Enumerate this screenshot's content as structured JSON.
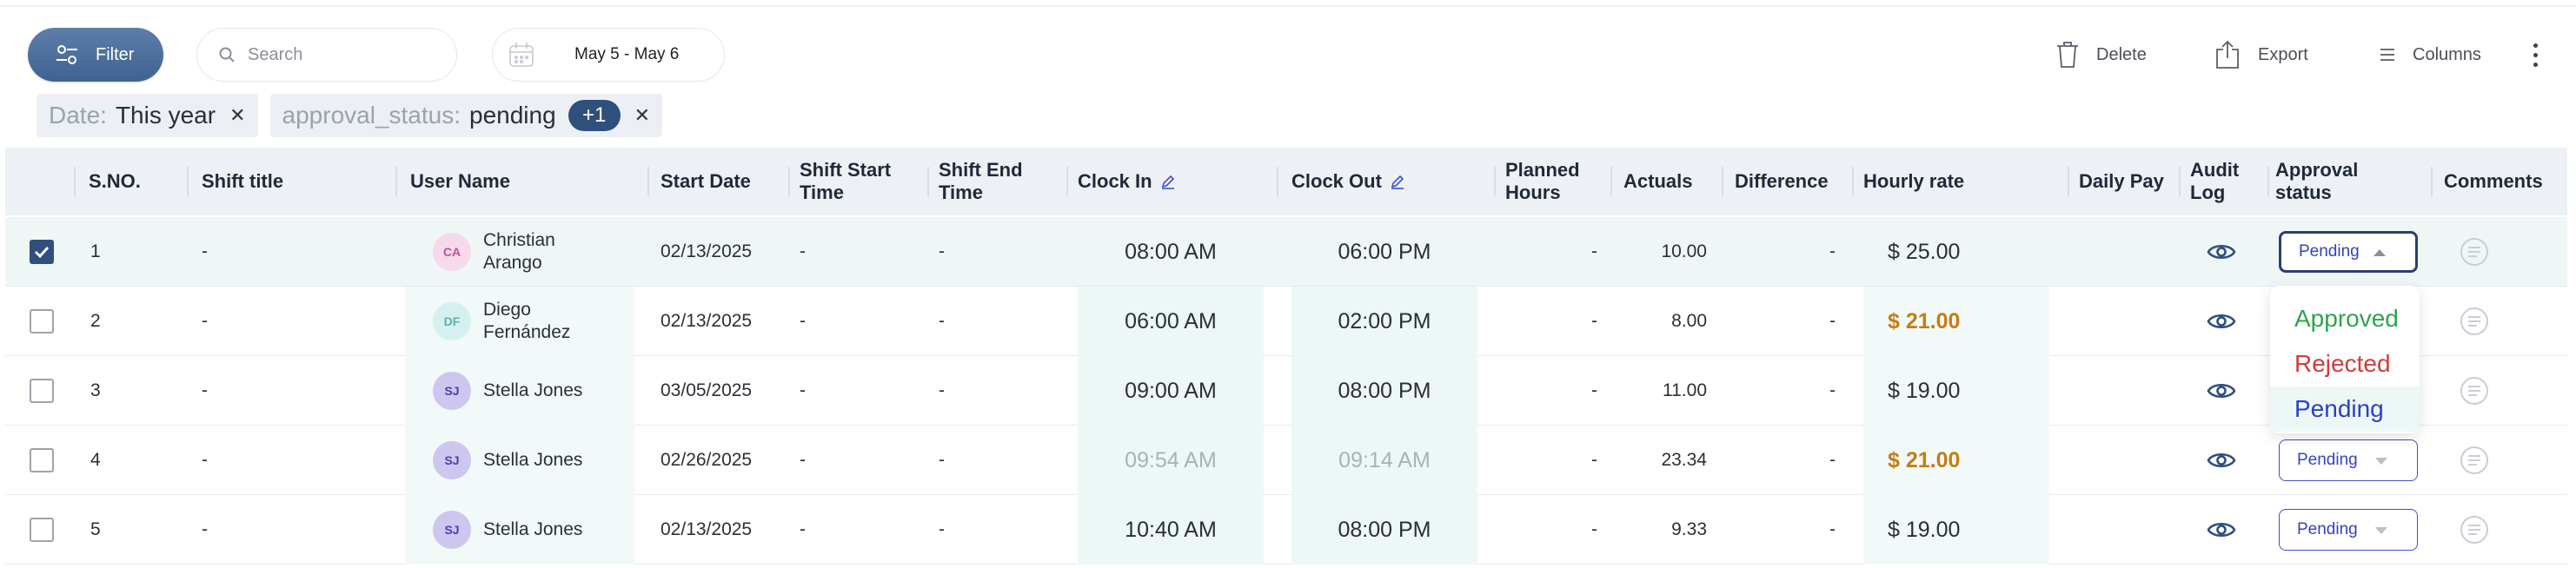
{
  "toolbar": {
    "filter_label": "Filter",
    "search_placeholder": "Search",
    "date_range": "May 5 - May 6",
    "delete_label": "Delete",
    "export_label": "Export",
    "columns_label": "Columns"
  },
  "chips": [
    {
      "key": "Date:",
      "value": "This year"
    },
    {
      "key": "approval_status:",
      "value": "pending",
      "extra": "+1"
    }
  ],
  "columns": {
    "sno": "S.NO.",
    "shift_title": "Shift title",
    "user_name": "User Name",
    "start_date": "Start Date",
    "shift_start": "Shift Start Time",
    "shift_end": "Shift End Time",
    "clock_in": "Clock In",
    "clock_out": "Clock Out",
    "planned_hours": "Planned Hours",
    "actuals": "Actuals",
    "difference": "Difference",
    "hourly_rate": "Hourly rate",
    "daily_pay": "Daily Pay",
    "audit_log": "Audit Log",
    "approval_status": "Approval status",
    "comments": "Comments"
  },
  "rows": [
    {
      "sno": "1",
      "shift_title": "-",
      "initials": "CA",
      "user": "Christian Arango",
      "start_date": "02/13/2025",
      "shift_start": "-",
      "shift_end": "-",
      "clock_in": "08:00 AM",
      "clock_out": "06:00 PM",
      "planned": "-",
      "actuals": "10.00",
      "difference": "-",
      "rate": "$ 25.00",
      "status": "Pending"
    },
    {
      "sno": "2",
      "shift_title": "-",
      "initials": "DF",
      "user": "Diego Fernández",
      "start_date": "02/13/2025",
      "shift_start": "-",
      "shift_end": "-",
      "clock_in": "06:00 AM",
      "clock_out": "02:00 PM",
      "planned": "-",
      "actuals": "8.00",
      "difference": "-",
      "rate": "$ 21.00",
      "status": "Pending"
    },
    {
      "sno": "3",
      "shift_title": "-",
      "initials": "SJ",
      "user": "Stella Jones",
      "start_date": "03/05/2025",
      "shift_start": "-",
      "shift_end": "-",
      "clock_in": "09:00 AM",
      "clock_out": "08:00 PM",
      "planned": "-",
      "actuals": "11.00",
      "difference": "-",
      "rate": "$ 19.00",
      "status": "Pending"
    },
    {
      "sno": "4",
      "shift_title": "-",
      "initials": "SJ",
      "user": "Stella Jones",
      "start_date": "02/26/2025",
      "shift_start": "-",
      "shift_end": "-",
      "clock_in": "09:54 AM",
      "clock_out": "09:14 AM",
      "planned": "-",
      "actuals": "23.34",
      "difference": "-",
      "rate": "$ 21.00",
      "status": "Pending"
    },
    {
      "sno": "5",
      "shift_title": "-",
      "initials": "SJ",
      "user": "Stella Jones",
      "start_date": "02/13/2025",
      "shift_start": "-",
      "shift_end": "-",
      "clock_in": "10:40 AM",
      "clock_out": "08:00 PM",
      "planned": "-",
      "actuals": "9.33",
      "difference": "-",
      "rate": "$ 19.00",
      "status": "Pending"
    }
  ],
  "status_options": [
    "Approved",
    "Rejected",
    "Pending"
  ],
  "colors": {
    "primary": "#2f4f7c",
    "approved": "#2ea44f",
    "rejected": "#d23b3b",
    "pending": "#2a3fc7",
    "rate_highlight": "#c77d12"
  }
}
